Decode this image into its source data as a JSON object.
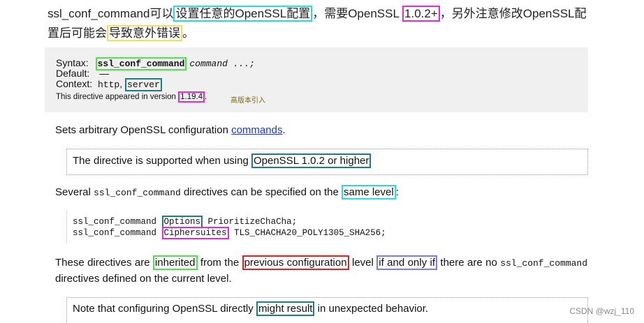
{
  "top": {
    "t1": "ssl_conf_command可以",
    "h1": "设置任意的OpenSSL配置",
    "t2": "，需要OpenSSL ",
    "h2": "1.0.2+",
    "t3": "，另外注意修改OpenSSL配",
    "t4": "置后可能会",
    "h3": "导致意外错误",
    "t5": "。"
  },
  "syntax": {
    "syntax_label": "Syntax:",
    "directive": "ssl_conf_command",
    "args": "command ...;",
    "default_label": "Default:",
    "default_value": "—",
    "context_label": "Context:",
    "context_http": "http",
    "context_sep": ", ",
    "context_server": "server",
    "appeared_prefix": "This directive appeared in version ",
    "version": "1.19.4",
    "appeared_suffix": ".",
    "note_cn": "高版本引入"
  },
  "sets": {
    "text": "Sets arbitrary OpenSSL configuration ",
    "link": "commands",
    "end": "."
  },
  "note1": {
    "text": "The directive is supported when using ",
    "highlight": "OpenSSL 1.0.2 or higher"
  },
  "several": {
    "t1": "Several ",
    "code": "ssl_conf_command",
    "t2": " directives can be specified on the ",
    "highlight": "same level",
    "t3": ":"
  },
  "code": {
    "line1_pre": "ssl_conf_command ",
    "line1_hl": "Options",
    "line1_post": " PrioritizeChaCha;",
    "line2_pre": "ssl_conf_command ",
    "line2_hl": "Ciphersuites",
    "line2_post": " TLS_CHACHA20_POLY1305_SHA256;"
  },
  "inherit": {
    "t1": "These directives are ",
    "h1": "inherited",
    "t2": " from the ",
    "h2": "previous configuration",
    "t3": " level ",
    "h3": "if and only if",
    "t4": " there are no ",
    "code": "ssl_conf_command",
    "t5": " directives defined on the current level."
  },
  "note2": {
    "t1": "Note that configuring OpenSSL directly ",
    "highlight": "might result",
    "t2": " in unexpected behavior."
  },
  "watermark": "CSDN @wzj_110"
}
